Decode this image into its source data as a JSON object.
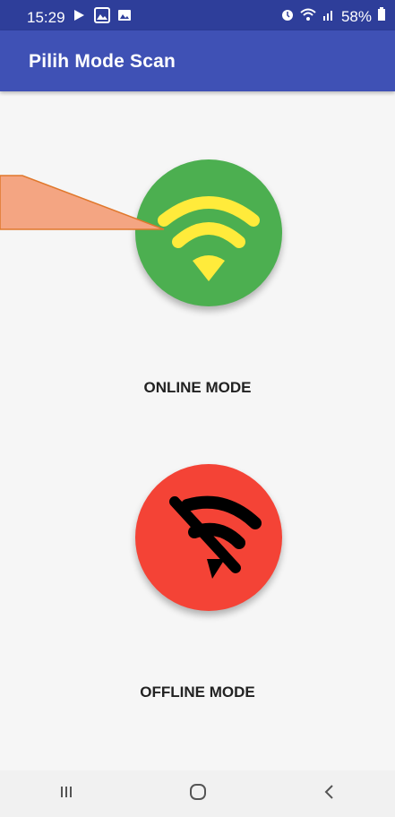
{
  "status_bar": {
    "time": "15:29",
    "battery": "58%",
    "icons_left": [
      "play-icon",
      "photo-icon",
      "image-icon"
    ],
    "icons_right": [
      "alarm-icon",
      "wifi-icon",
      "signal-icon",
      "battery-icon"
    ]
  },
  "app_bar": {
    "title": "Pilih Mode Scan"
  },
  "modes": {
    "online": {
      "label": "ONLINE MODE",
      "icon": "wifi-icon",
      "color": "#4caf50",
      "icon_color": "#ffeb3b"
    },
    "offline": {
      "label": "OFFLINE MODE",
      "icon": "wifi-off-icon",
      "color": "#f44336",
      "icon_color": "#000000"
    }
  },
  "annotation": {
    "type": "callout-arrow",
    "color": "#f4a582"
  },
  "nav_bar": {
    "items": [
      "recent-apps-icon",
      "home-icon",
      "back-icon"
    ]
  }
}
